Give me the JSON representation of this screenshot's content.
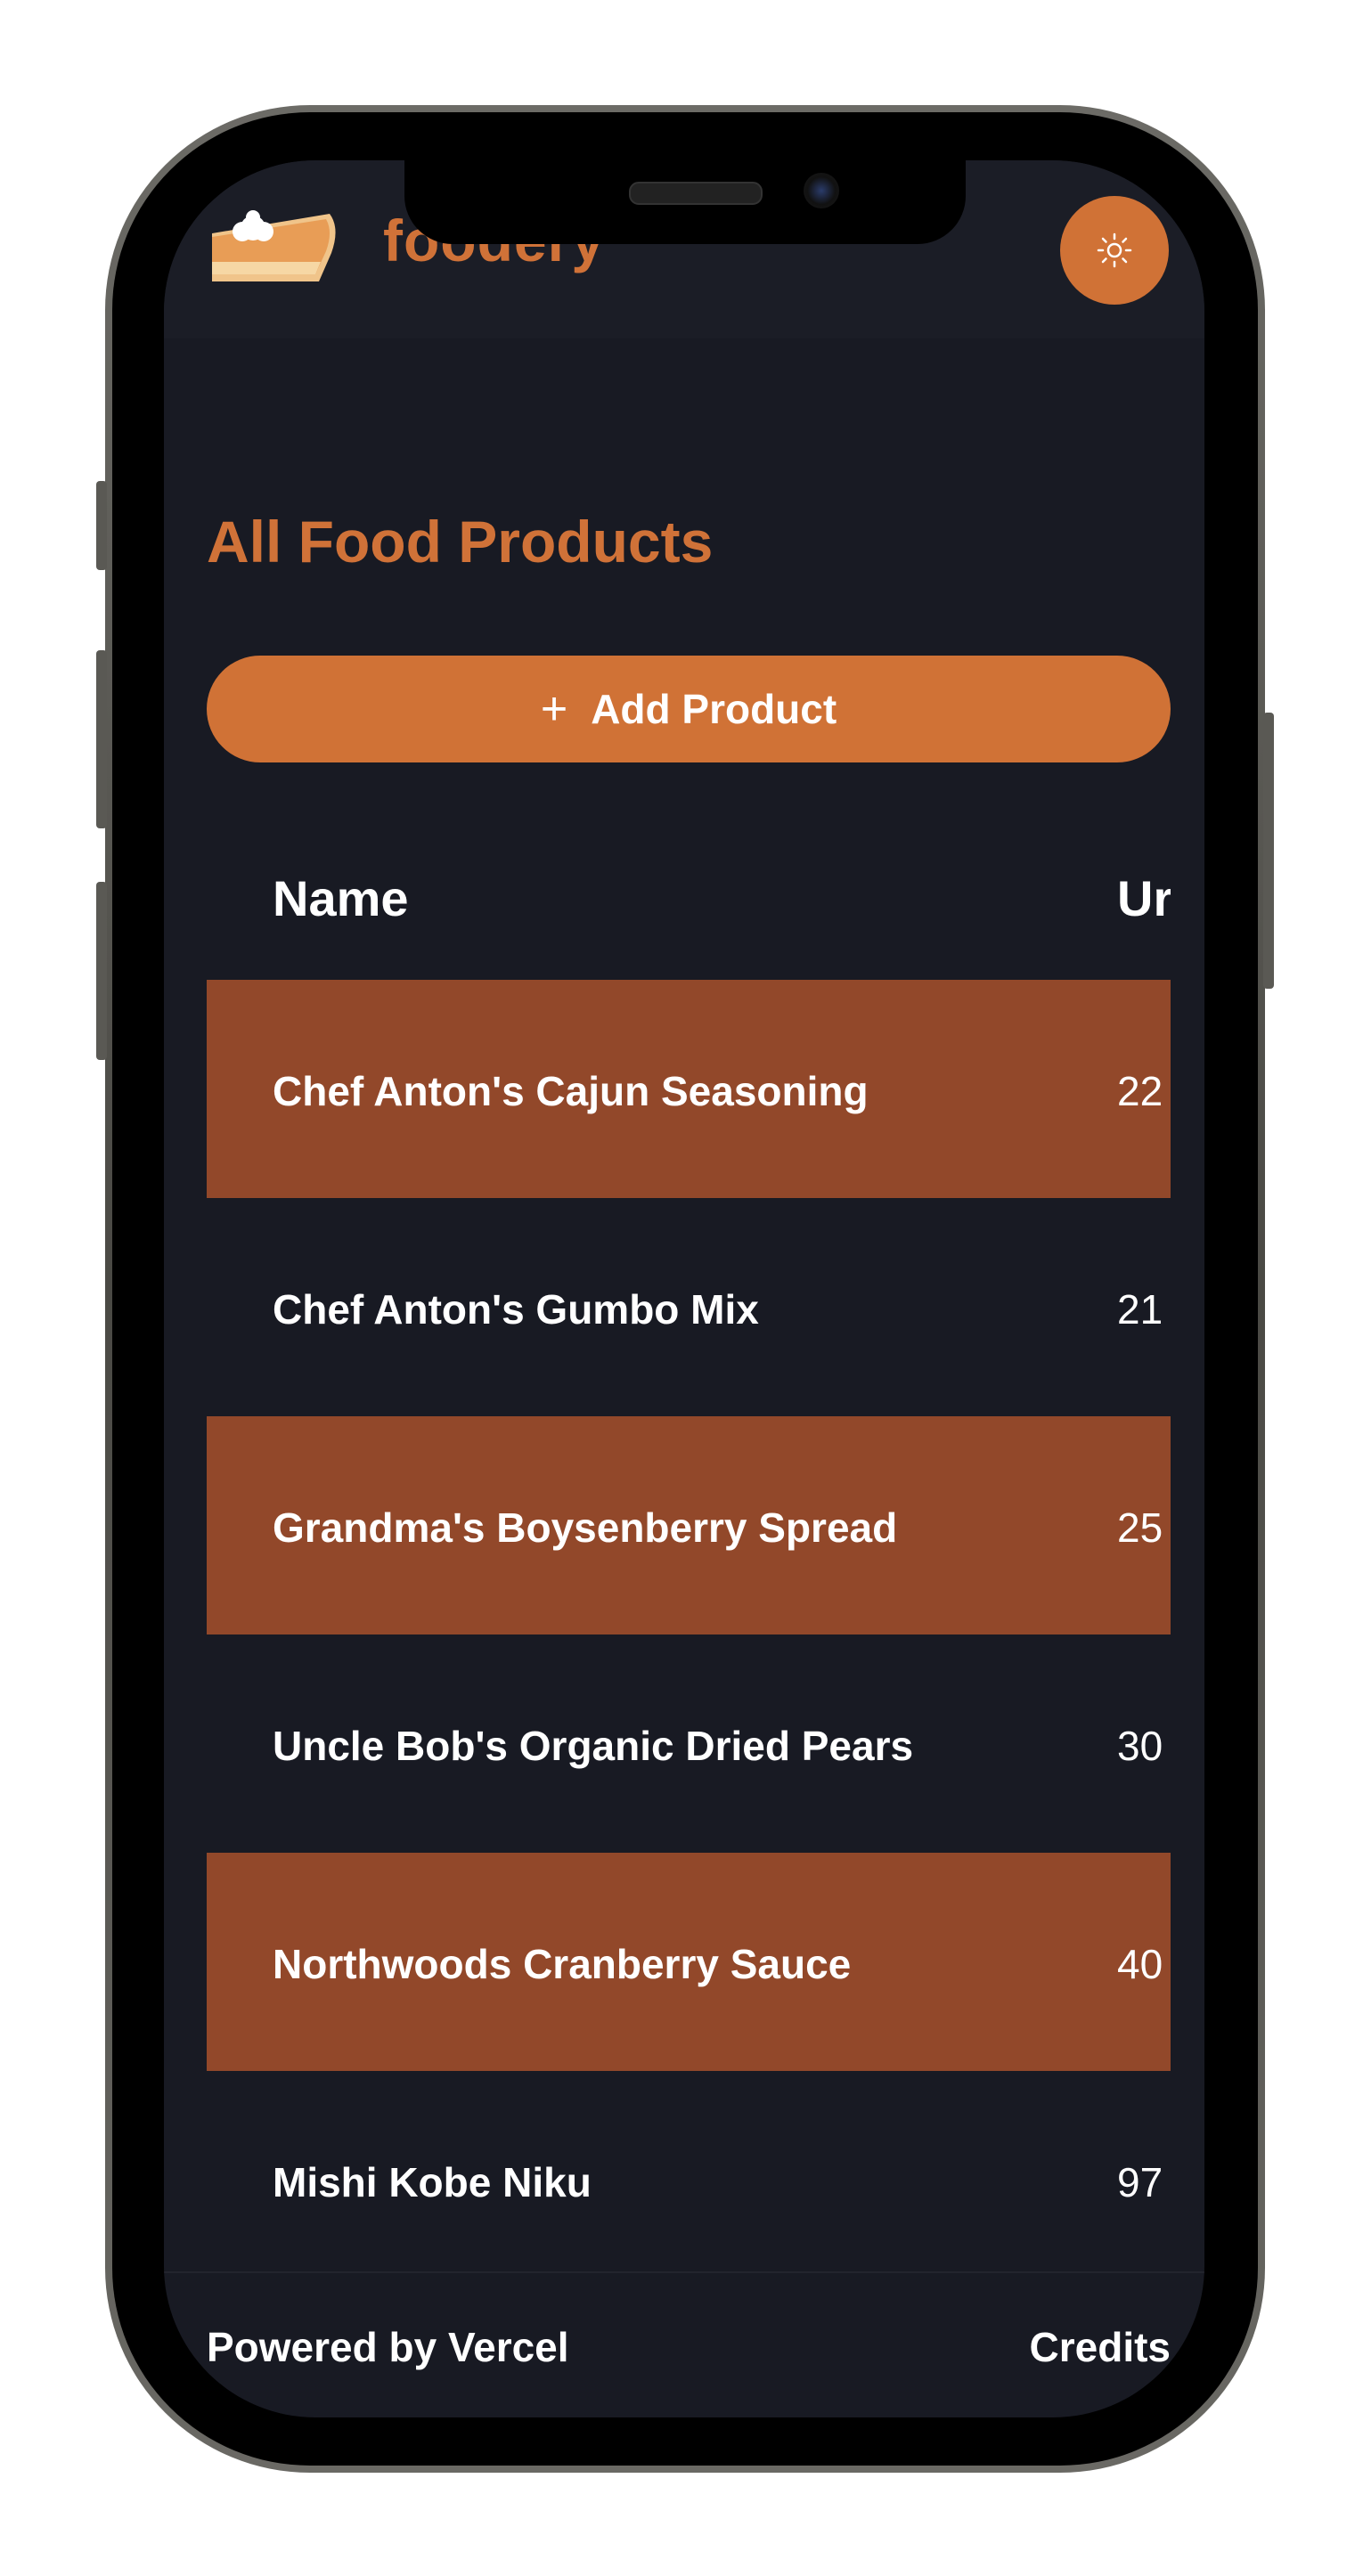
{
  "header": {
    "brand": "foodery",
    "logo_icon": "pie-slice-icon",
    "theme_toggle_icon": "sun-icon"
  },
  "main": {
    "title": "All Food Products",
    "add_button": {
      "icon": "plus-icon",
      "label": "Add Product"
    },
    "table": {
      "columns": [
        "Name",
        "Ur"
      ],
      "rows": [
        {
          "name": "Chef Anton's Cajun Seasoning",
          "unit": "22"
        },
        {
          "name": "Chef Anton's Gumbo Mix",
          "unit": "21"
        },
        {
          "name": "Grandma's Boysenberry Spread",
          "unit": "25"
        },
        {
          "name": "Uncle Bob's Organic Dried Pears",
          "unit": "30"
        },
        {
          "name": "Northwoods Cranberry Sauce",
          "unit": "40"
        },
        {
          "name": "Mishi Kobe Niku",
          "unit": "97"
        }
      ]
    }
  },
  "footer": {
    "left": "Powered by Vercel",
    "right": "Credits"
  },
  "colors": {
    "accent": "#d07236",
    "row_highlight": "#92482a",
    "background": "#181a23"
  }
}
